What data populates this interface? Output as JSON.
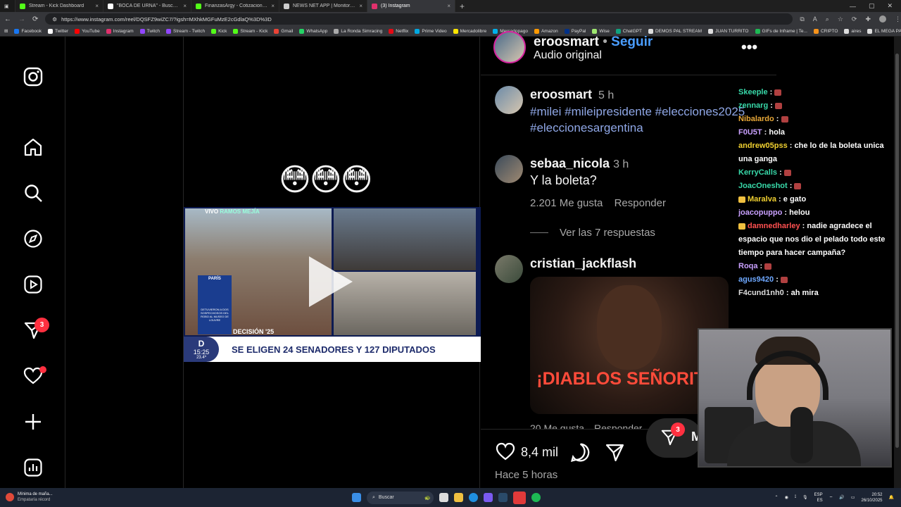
{
  "browser": {
    "tabs": [
      {
        "title": "Stream - Kick Dashboard",
        "color": "#53fc18"
      },
      {
        "title": "\"BOCA DE URNA\" - Buscar / X",
        "color": "#ffffff"
      },
      {
        "title": "FinanzasArgy - Cotizaciones en ti...",
        "color": "#53fc18"
      },
      {
        "title": "NEWS NET APP | Monitoreo de m...",
        "color": "#cccccc"
      },
      {
        "title": "(3) Instagram",
        "color": "#e1306c"
      }
    ],
    "url": "https://www.instagram.com/reel/DQSFZ9wiZC7/?igsh=MXhkMGFuMzE2cGdlaQ%3D%3D",
    "bookmarks": [
      "Facebook",
      "Twitter",
      "YouTube",
      "Instagram",
      "Twitch",
      "Stream - Twitch",
      "Kick",
      "Stream - Kick",
      "Gmail",
      "WhatsApp",
      "La Ronda Simracing",
      "Netflix",
      "Prime Video",
      "Mercadolibre",
      "Mercadopago",
      "Amazon",
      "PayPal",
      "Wise",
      "ChatGPT",
      "DEMOS PAL STREAM",
      "JUAN TURRITO",
      "GIFs de Inframe | Te...",
      "CRIPTO",
      "aires",
      "EL MEGA PACK PAP..."
    ]
  },
  "nav": {
    "messages_badge": "3",
    "items": [
      "instagram-logo",
      "home",
      "search",
      "explore",
      "reels",
      "messages",
      "notifications",
      "create",
      "dashboard"
    ]
  },
  "reel": {
    "emojis": "😳😳😳",
    "news": {
      "live": "VIVO",
      "location": "RAMOS MEJÍA",
      "paris": "PARÍS",
      "paris_sub": "DETUVIERON A DOS SOSPECHOSOS DEL ROBO AL MUSEO DE LOUVRE",
      "decision": "DECISIÓN '25",
      "channel_time": "15:25",
      "channel_temp": "23.4º",
      "headline": "SE ELIGEN 24 SENADORES Y 127 DIPUTADOS"
    }
  },
  "post": {
    "author": "eroosmart",
    "follow": "Seguir",
    "separator": "•",
    "audio": "Audio original",
    "caption_time": "5 h",
    "hashtags_line1": "#milei #mileipresidente #elecciones2025",
    "hashtags_line2": "#eleccionesargentina",
    "comments": [
      {
        "user": "sebaa_nicola",
        "time": "3 h",
        "text": "Y la boleta?",
        "likes": "2.201 Me gusta",
        "reply": "Responder",
        "view_replies": "Ver las 7 respuestas"
      },
      {
        "user": "cristian_jackflash",
        "gif_text": "¡DIABLOS SEÑORITA!",
        "likes_partial": "20 Me gusta",
        "reply": "Responder"
      }
    ],
    "like_count": "8,4 mil",
    "posted": "Hace 5 horas",
    "float_badge": "3",
    "float_initial": "M"
  },
  "chat": [
    {
      "user": "Skeeple",
      "color": "#38d9a9",
      "msg": "",
      "emote": true
    },
    {
      "user": "zennarg",
      "color": "#38d9a9",
      "msg": "",
      "emote": true
    },
    {
      "user": "Nibalardo",
      "color": "#e8a838",
      "msg": "",
      "emote": true
    },
    {
      "user": "F0U5T",
      "color": "#c9a0ff",
      "msg": "hola",
      "emote": false
    },
    {
      "user": "andrew05pss",
      "color": "#f0d030",
      "msg": "che lo de la boleta unica una ganga",
      "emote": false
    },
    {
      "user": "KerryCalls",
      "color": "#38d9a9",
      "msg": "",
      "emote": true
    },
    {
      "user": "JoacOneshot",
      "color": "#38d9a9",
      "msg": "",
      "emote": true
    },
    {
      "user": "Maralva",
      "color": "#f0d030",
      "msg": "e gato",
      "emote": false,
      "badges": true
    },
    {
      "user": "joacopuppo",
      "color": "#c9a0ff",
      "msg": "helou",
      "emote": false
    },
    {
      "user": "damnedharley",
      "color": "#ff5050",
      "msg": "nadie agradece el espacio que nos dio el pelado todo este tiempo para hacer campaña?",
      "emote": false,
      "badges": true
    },
    {
      "user": "Roqa",
      "color": "#c9a0ff",
      "msg": "",
      "emote": true
    },
    {
      "user": "agus9420",
      "color": "#6ea8ff",
      "msg": "",
      "emote": true
    },
    {
      "user": "F4cund1nh0",
      "color": "#dddddd",
      "msg": "ah mira",
      "emote": false
    }
  ],
  "taskbar": {
    "notification_title": "Mínima de maña...",
    "notification_sub": "Empataría récord",
    "search": "Buscar",
    "lang": "ESP",
    "lang_sub": "ES",
    "time": "20:52",
    "date": "26/10/2025"
  }
}
